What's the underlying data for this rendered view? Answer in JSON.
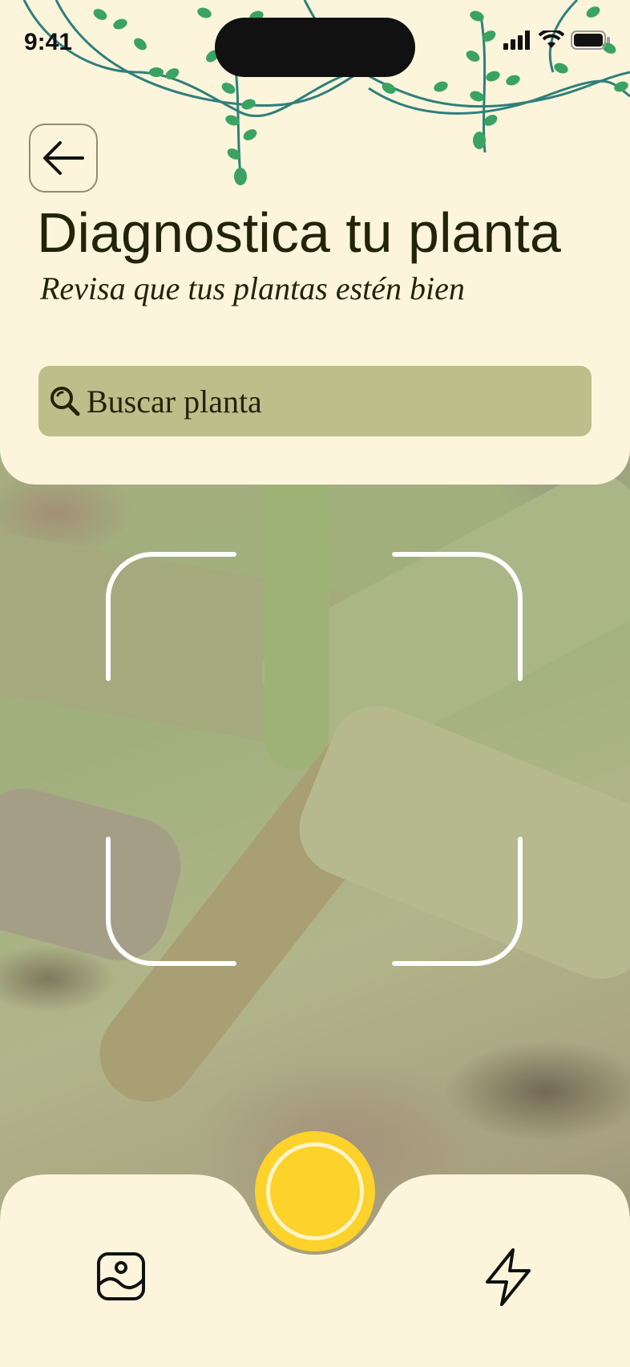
{
  "status_bar": {
    "time": "9:41"
  },
  "header": {
    "title": "Diagnostica tu planta",
    "subtitle": "Revisa que tus plantas estén bien"
  },
  "search": {
    "placeholder": "Buscar planta"
  },
  "icons": {
    "back": "arrow-left-icon",
    "search": "magnifier-icon",
    "gallery": "image-icon",
    "flash": "lightning-icon",
    "signal": "signal-icon",
    "wifi": "wifi-icon",
    "battery": "battery-icon"
  },
  "colors": {
    "background": "#fcf5dc",
    "search_bg": "#bdbf8a",
    "shutter": "#fcd22b",
    "text": "#222409",
    "vine": "#2f7f7a",
    "leaf": "#3aa364"
  }
}
